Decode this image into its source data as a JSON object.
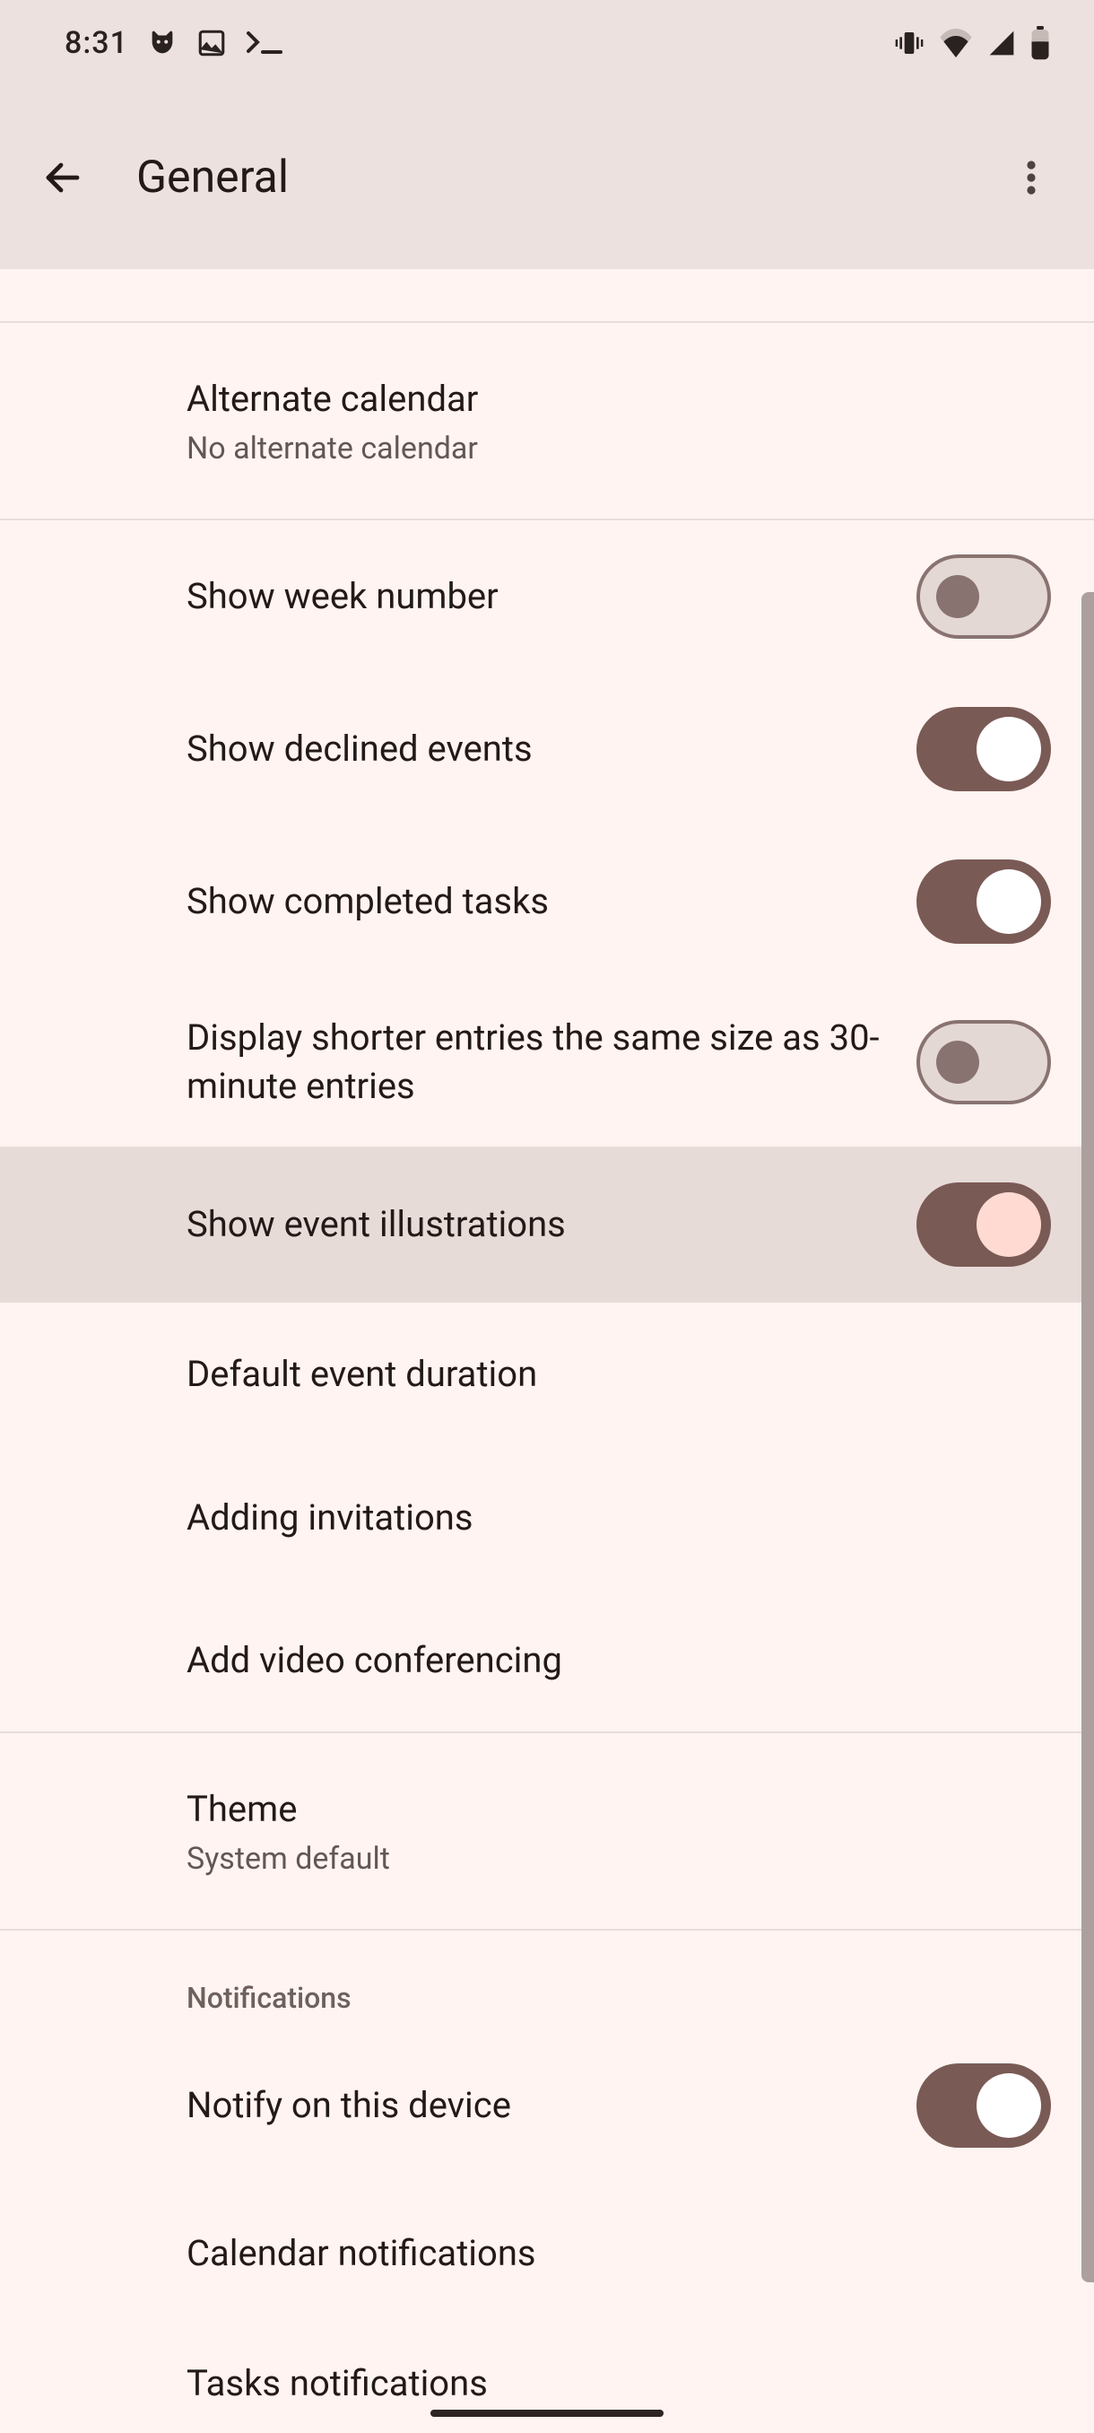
{
  "status": {
    "time": "8:31"
  },
  "appbar": {
    "title": "General"
  },
  "rows": {
    "alternate_calendar": {
      "title": "Alternate calendar",
      "subtitle": "No alternate calendar"
    },
    "show_week_number": {
      "title": "Show week number"
    },
    "show_declined_events": {
      "title": "Show declined events"
    },
    "show_completed_tasks": {
      "title": "Show completed tasks"
    },
    "display_shorter": {
      "title": "Display shorter entries the same size as 30-minute entries"
    },
    "show_event_illustrations": {
      "title": "Show event illustrations"
    },
    "default_event_duration": {
      "title": "Default event duration"
    },
    "adding_invitations": {
      "title": "Adding invitations"
    },
    "add_video_conferencing": {
      "title": "Add video conferencing"
    },
    "theme": {
      "title": "Theme",
      "subtitle": "System default"
    },
    "notify_device": {
      "title": "Notify on this device"
    },
    "calendar_notifications": {
      "title": "Calendar notifications"
    },
    "tasks_notifications": {
      "title": "Tasks notifications"
    }
  },
  "sections": {
    "notifications": "Notifications"
  }
}
